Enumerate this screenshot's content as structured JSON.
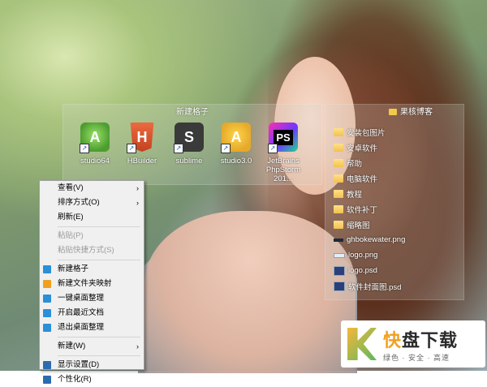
{
  "fences": {
    "left": {
      "title": "新建格子",
      "icons": [
        {
          "label": "studio64",
          "icon": "android-studio-icon",
          "glyph": "A"
        },
        {
          "label": "HBuilder",
          "icon": "hbuilder-icon",
          "glyph": "H"
        },
        {
          "label": "sublime",
          "icon": "sublime-text-icon",
          "glyph": "S"
        },
        {
          "label": "studio3.0",
          "icon": "android-studio-3-icon",
          "glyph": "A"
        },
        {
          "label": "JetBrains PhpStorm 201...",
          "icon": "phpstorm-icon",
          "glyph": "PS"
        }
      ]
    },
    "right": {
      "title": "果核博客",
      "files": [
        {
          "name": "安装包图片",
          "type": "folder"
        },
        {
          "name": "安卓软件",
          "type": "folder"
        },
        {
          "name": "帮助",
          "type": "folder"
        },
        {
          "name": "电脑软件",
          "type": "folder"
        },
        {
          "name": "教程",
          "type": "folder"
        },
        {
          "name": "软件补丁",
          "type": "folder"
        },
        {
          "name": "缩略图",
          "type": "folder"
        },
        {
          "name": "ghbokewater.png",
          "type": "png-dark"
        },
        {
          "name": "logo.png",
          "type": "png-light"
        },
        {
          "name": "logo.psd",
          "type": "psd"
        },
        {
          "name": "软件封面图.psd",
          "type": "psd"
        }
      ]
    }
  },
  "context_menu": {
    "items": [
      {
        "label": "查看(V)",
        "submenu": true
      },
      {
        "label": "排序方式(O)",
        "submenu": true
      },
      {
        "label": "刷新(E)"
      },
      {
        "sep": true
      },
      {
        "label": "粘贴(P)",
        "disabled": true
      },
      {
        "label": "粘贴快捷方式(S)",
        "disabled": true
      },
      {
        "sep": true
      },
      {
        "label": "新建格子",
        "icon": "add-fence-icon",
        "color": "#2b8fd9"
      },
      {
        "label": "新建文件夹映射",
        "icon": "folder-map-icon",
        "color": "#f0a020"
      },
      {
        "label": "一键桌面整理",
        "icon": "desktop-organize-icon",
        "color": "#2b8fd9"
      },
      {
        "label": "开启最近文档",
        "icon": "recent-docs-icon",
        "color": "#2b8fd9"
      },
      {
        "label": "退出桌面整理",
        "icon": "exit-organize-icon",
        "color": "#2b8fd9"
      },
      {
        "sep": true
      },
      {
        "label": "新建(W)",
        "submenu": true
      },
      {
        "sep": true
      },
      {
        "label": "显示设置(D)",
        "icon": "display-settings-icon",
        "color": "#2b6cb0"
      },
      {
        "label": "个性化(R)",
        "icon": "personalize-icon",
        "color": "#2b6cb0"
      }
    ],
    "submenu_arrow": "›"
  },
  "logo": {
    "main_a": "快",
    "main_b": "盘下载",
    "sub": "绿色 · 安全 · 高速"
  },
  "shortcut_arrow": "↗"
}
